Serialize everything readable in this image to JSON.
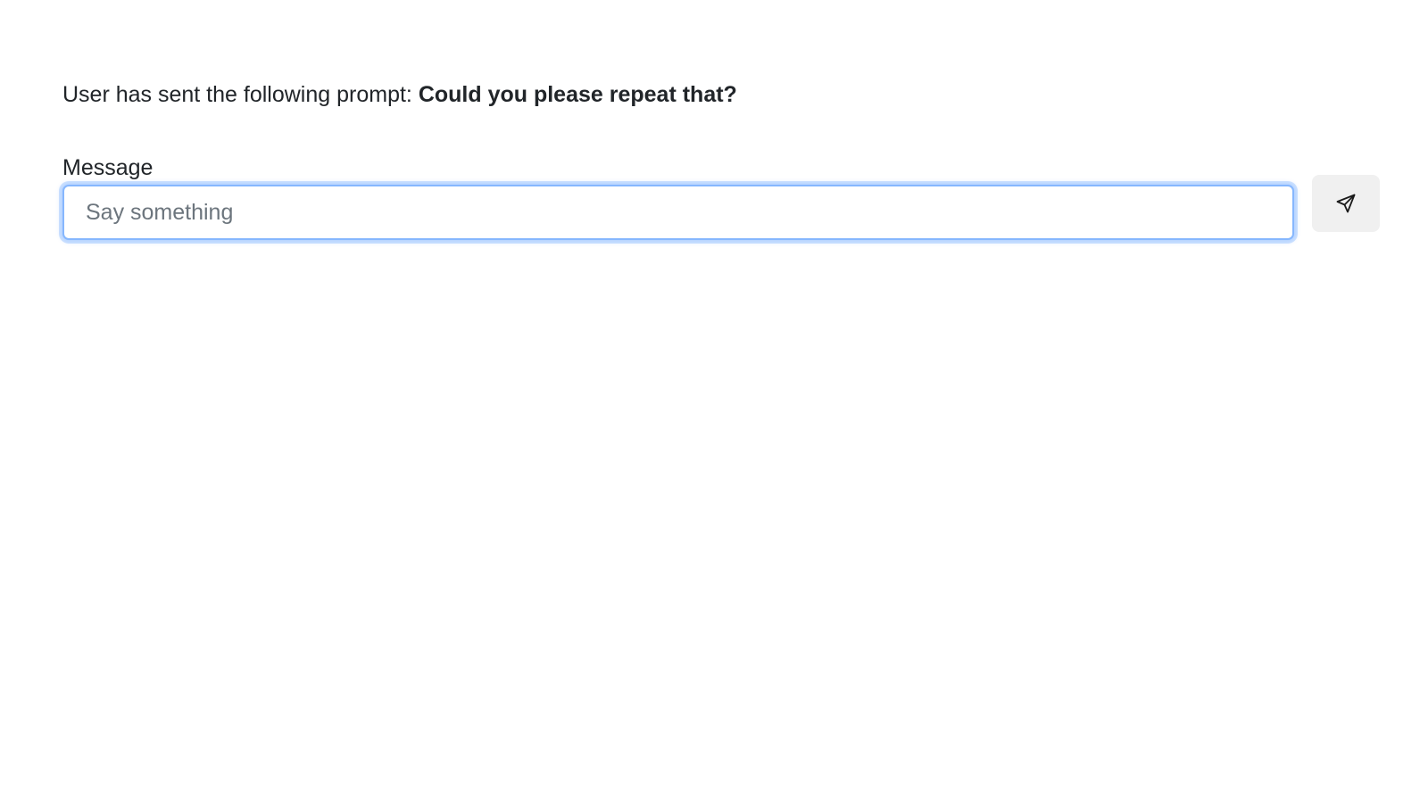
{
  "prompt": {
    "prefix": "User has sent the following prompt: ",
    "text": "Could you please repeat that?"
  },
  "form": {
    "label": "Message",
    "input_placeholder": "Say something",
    "input_value": "",
    "send_icon": "send-icon"
  },
  "colors": {
    "focus_border": "#86b7fe",
    "button_bg": "#f0f0f0",
    "text": "#212529",
    "placeholder": "#6c757d"
  }
}
